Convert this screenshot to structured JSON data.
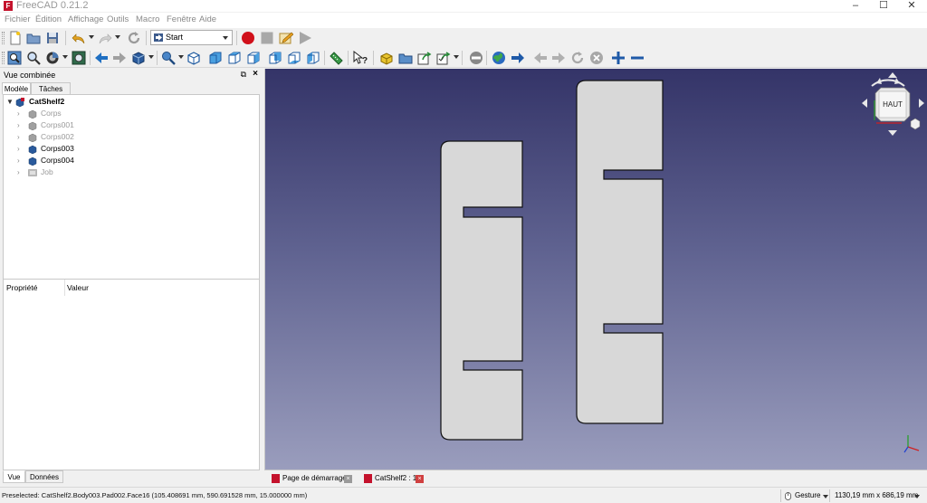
{
  "window": {
    "title": "FreeCAD 0.21.2"
  },
  "menu": [
    "Fichier",
    "Édition",
    "Affichage",
    "Outils",
    "Macro",
    "Fenêtre",
    "Aide"
  ],
  "workbench": {
    "selected": "Start"
  },
  "combo_view": {
    "title": "Vue combinée",
    "tabs": [
      "Modèle",
      "Tâches"
    ],
    "active_tab": "Modèle",
    "tree": {
      "root": "CatShelf2",
      "items": [
        {
          "label": "Corps",
          "state": "hidden"
        },
        {
          "label": "Corps001",
          "state": "hidden"
        },
        {
          "label": "Corps002",
          "state": "hidden"
        },
        {
          "label": "Corps003",
          "state": "visible"
        },
        {
          "label": "Corps004",
          "state": "visible"
        },
        {
          "label": "Job",
          "state": "hidden"
        }
      ]
    },
    "properties": {
      "col_property": "Propriété",
      "col_value": "Valeur"
    },
    "bottom_tabs": [
      "Vue",
      "Données"
    ]
  },
  "navcube": {
    "face": "HAUT"
  },
  "doc_tabs": [
    {
      "label": "Page de démarrage",
      "active": false
    },
    {
      "label": "CatShelf2 : 1*",
      "active": true
    }
  ],
  "status": {
    "preselected": "Preselected: CatShelf2.Body003.Pad002.Face16 (105.408691 mm, 590.691528 mm, 15.000000 mm)",
    "nav_style": "Gesture",
    "dimensions": "1130,19 mm x 686,19 mm"
  },
  "colors": {
    "accent": "#c4122c",
    "view_top": "#343468",
    "view_bottom": "#9a9dbd",
    "part_fill": "#d8d8d8"
  }
}
